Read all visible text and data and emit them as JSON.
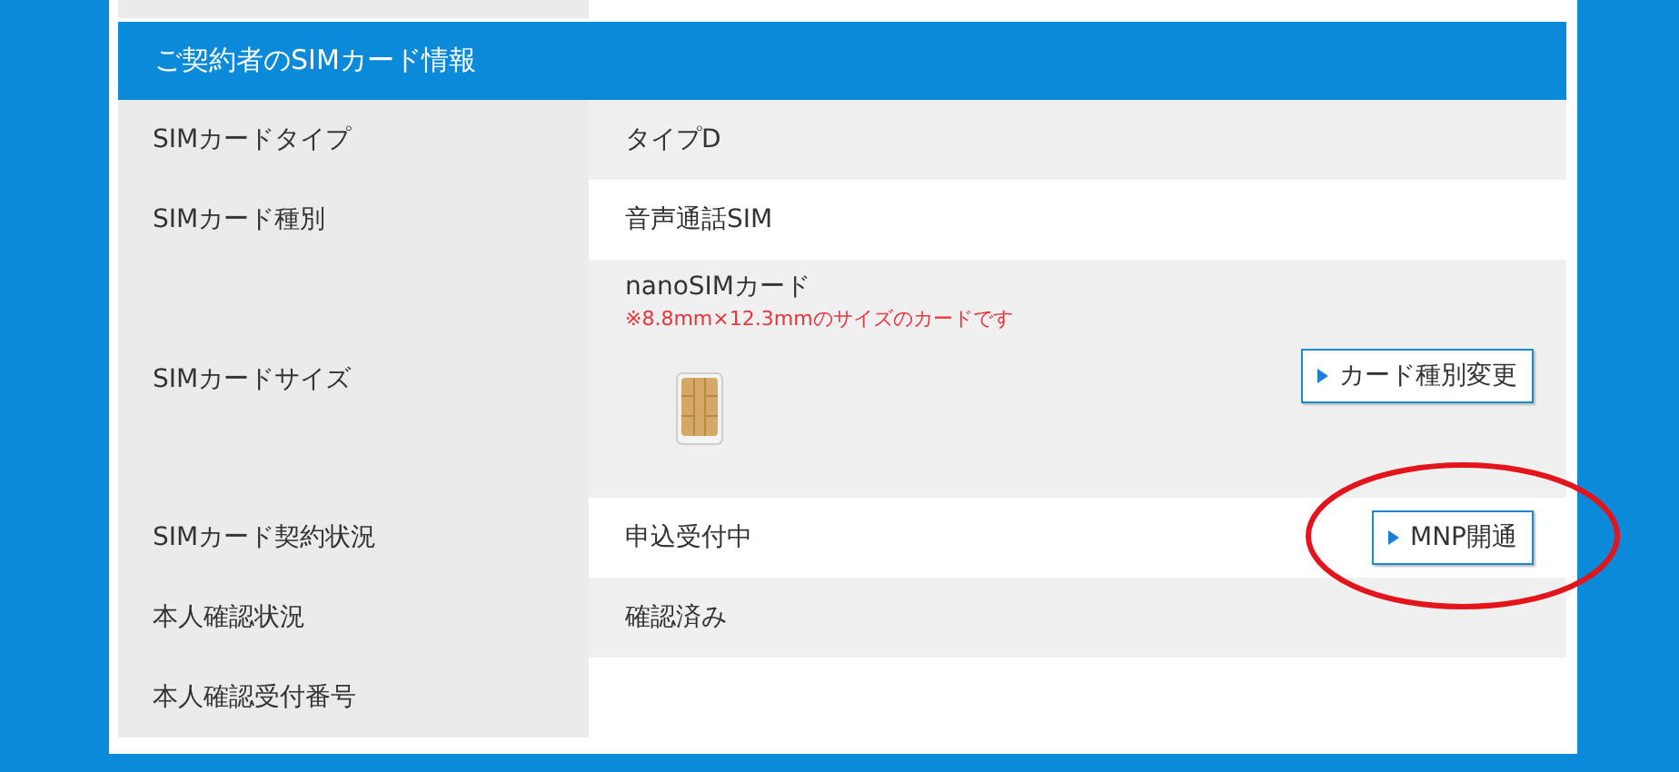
{
  "section": {
    "title": "ご契約者のSIMカード情報"
  },
  "rows": [
    {
      "label": "SIMカードタイプ",
      "value": "タイプD"
    },
    {
      "label": "SIMカード種別",
      "value": "音声通話SIM"
    },
    {
      "label": "SIMカードサイズ",
      "value": "nanoSIMカード",
      "note": "※8.8mm×12.3mmのサイズのカードです",
      "button": "カード種別変更",
      "sim_image": true
    },
    {
      "label": "SIMカード契約状況",
      "value": "申込受付中",
      "button": "MNP開通",
      "circled": true
    },
    {
      "label": "本人確認状況",
      "value": "確認済み"
    },
    {
      "label": "本人確認受付番号"
    }
  ]
}
